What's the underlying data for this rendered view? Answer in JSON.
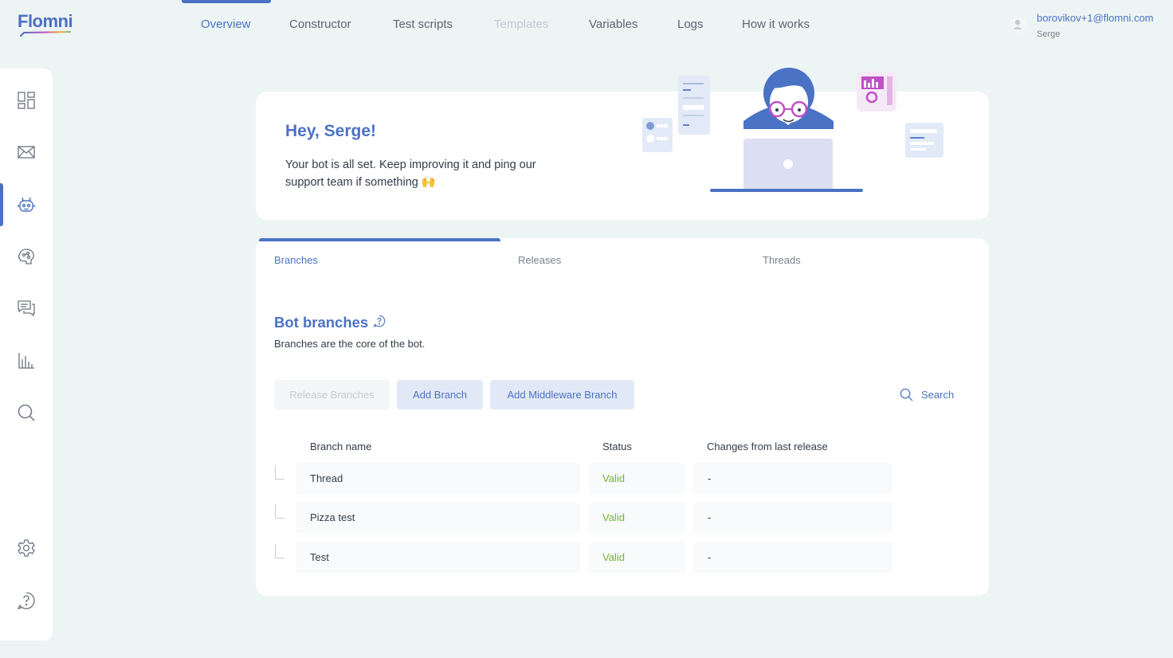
{
  "app": {
    "logo_text": "Flomni"
  },
  "topnav": {
    "tabs": [
      {
        "label": "Overview",
        "state": "active"
      },
      {
        "label": "Constructor",
        "state": "normal"
      },
      {
        "label": "Test scripts",
        "state": "normal"
      },
      {
        "label": "Templates",
        "state": "disabled"
      },
      {
        "label": "Variables",
        "state": "normal"
      },
      {
        "label": "Logs",
        "state": "normal"
      },
      {
        "label": "How it works",
        "state": "normal"
      }
    ]
  },
  "user": {
    "email": "borovikov+1@flomni.com",
    "name": "Serge",
    "avatar_icon": "user-icon"
  },
  "sidebar": {
    "items": [
      {
        "icon": "dashboard-icon"
      },
      {
        "icon": "mail-icon"
      },
      {
        "icon": "bot-icon",
        "active": true
      },
      {
        "icon": "brain-icon"
      },
      {
        "icon": "chat-icon"
      },
      {
        "icon": "chart-icon"
      },
      {
        "icon": "search-icon"
      },
      {
        "icon": "settings-icon"
      },
      {
        "icon": "help-icon"
      }
    ]
  },
  "welcome": {
    "greeting": "Hey, Serge!",
    "message": "Your bot is all set. Keep improving it and ping our support team if something 🙌"
  },
  "content_tabs": [
    {
      "label": "Branches",
      "active": true
    },
    {
      "label": "Releases",
      "active": false
    },
    {
      "label": "Threads",
      "active": false
    }
  ],
  "branches": {
    "title": "Bot branches",
    "subtitle": "Branches are the core of the bot.",
    "buttons": {
      "release": "Release Branches",
      "add": "Add Branch",
      "add_middleware": "Add Middleware Branch"
    },
    "search_label": "Search",
    "columns": {
      "name": "Branch name",
      "status": "Status",
      "changes": "Changes from last release"
    },
    "rows": [
      {
        "name": "Thread",
        "status": "Valid",
        "changes": "-"
      },
      {
        "name": "Pizza test",
        "status": "Valid",
        "changes": "-"
      },
      {
        "name": "Test",
        "status": "Valid",
        "changes": "-"
      }
    ]
  },
  "colors": {
    "accent": "#4a72c4",
    "valid": "#76b431",
    "background": "#edf4f4"
  }
}
